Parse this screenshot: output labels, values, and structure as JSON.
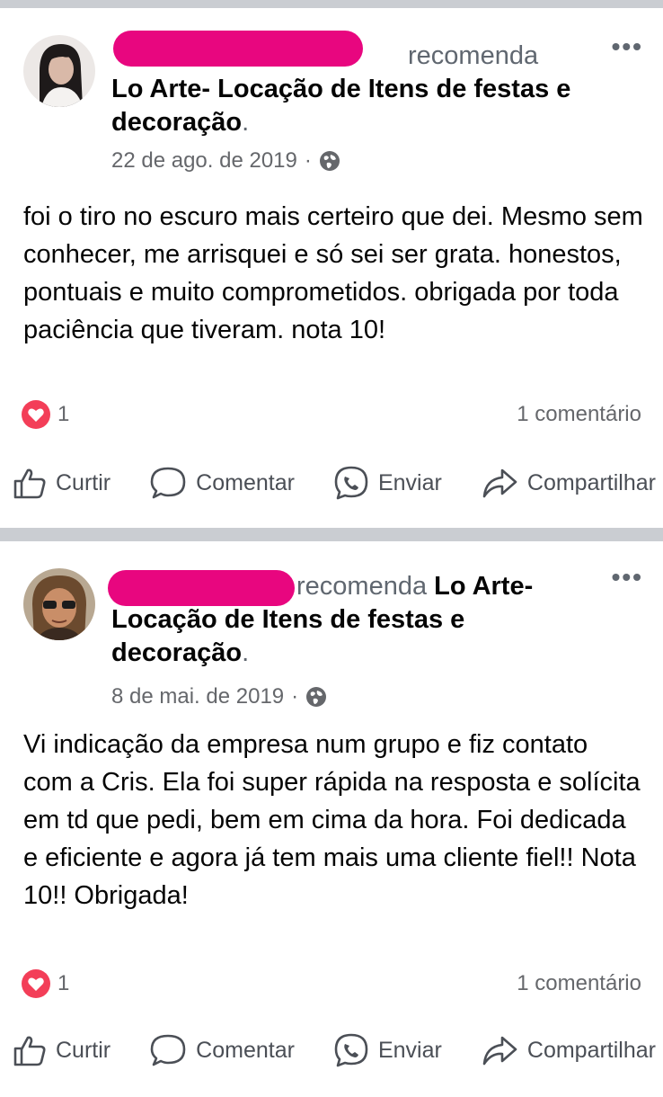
{
  "posts": [
    {
      "verb": "recomenda",
      "page_name": "Lo Arte- Locação de Itens de festas e decoração",
      "date": "22 de ago. de 2019",
      "separator": "·",
      "body": "foi o tiro no escuro mais certeiro que dei. Mesmo sem conhecer, me arrisquei e só sei ser grata. honestos, pontuais e muito comprometidos. obrigada por toda paciência que tiveram. nota 10!",
      "reaction_count": "1",
      "comments": "1 comentário"
    },
    {
      "verb": "recomenda",
      "page_name": "Lo Arte- Locação de Itens de festas e decoração",
      "date": "8 de mai. de 2019",
      "separator": "·",
      "body": "Vi indicação da empresa num grupo e fiz contato com a Cris. Ela foi super rápida na resposta e solícita em td que pedi, bem em cima da hora. Foi dedicada e eficiente e agora já tem mais uma cliente fiel!! Nota 10!! Obrigada!",
      "reaction_count": "1",
      "comments": "1 comentário"
    }
  ],
  "actions": {
    "like": "Curtir",
    "comment": "Comentar",
    "send": "Enviar",
    "share": "Compartilhar"
  },
  "more_label": "•••",
  "period": ".",
  "colors": {
    "redaction": "#e8067f",
    "reaction_heart": "#f33e58",
    "separator_bar": "#cacdd2"
  },
  "icons": [
    "more-options-icon",
    "globe-icon",
    "heart-reaction-icon",
    "like-icon",
    "comment-icon",
    "messenger-icon",
    "share-icon"
  ]
}
